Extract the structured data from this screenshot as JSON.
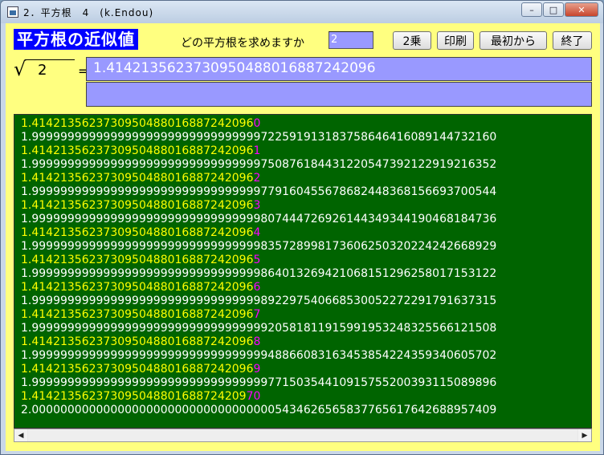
{
  "window": {
    "title": "2．平方根　4　(k.Endou)",
    "controls": {
      "minimize": "–",
      "maximize": "□",
      "close": "✕"
    }
  },
  "header": {
    "heading": "平方根の近似値",
    "question": "どの平方根を求めますか",
    "number_value": "2"
  },
  "buttons": {
    "square": "2乗",
    "print": "印刷",
    "restart": "最初から",
    "exit": "終了"
  },
  "formula": {
    "radicand": "2",
    "equals": "=",
    "result": "1.4142135623730950488016887242096",
    "result2": ""
  },
  "output": {
    "base": "1.4142135623730950488016887242096",
    "rows": [
      {
        "prefix": "1.4142135623730950488016887242096",
        "suffix": "0",
        "square": "1.99999999999999999999999999999999722591913183758646416089144732160"
      },
      {
        "prefix": "1.4142135623730950488016887242096",
        "suffix": "1",
        "square": "1.99999999999999999999999999999999750876184431220547392122919216352"
      },
      {
        "prefix": "1.4142135623730950488016887242096",
        "suffix": "2",
        "square": "1.99999999999999999999999999999999779160455678682448368156693700544"
      },
      {
        "prefix": "1.4142135623730950488016887242096",
        "suffix": "3",
        "square": "1.99999999999999999999999999999999807444726926144349344190468184736"
      },
      {
        "prefix": "1.4142135623730950488016887242096",
        "suffix": "4",
        "square": "1.99999999999999999999999999999999835728998173606250320224242668929"
      },
      {
        "prefix": "1.4142135623730950488016887242096",
        "suffix": "5",
        "square": "1.99999999999999999999999999999999864013269421068151296258017153122"
      },
      {
        "prefix": "1.4142135623730950488016887242096",
        "suffix": "6",
        "square": "1.99999999999999999999999999999999892297540668530052272291791637315"
      },
      {
        "prefix": "1.4142135623730950488016887242096",
        "suffix": "7",
        "square": "1.99999999999999999999999999999999920581811915991953248325566121508"
      },
      {
        "prefix": "1.4142135623730950488016887242096",
        "suffix": "8",
        "square": "1.99999999999999999999999999999999948866083163453854224359340605702"
      },
      {
        "prefix": "1.4142135623730950488016887242096",
        "suffix": "9",
        "square": "1.99999999999999999999999999999999977150354410915755200393115089896"
      },
      {
        "prefix": "1.414213562373095048801688724209",
        "suffix": "70",
        "square": "2.00000000000000000000000000000000005434626565837765617642688957409"
      }
    ]
  },
  "scrollbar": {
    "left_arrow": "◀",
    "right_arrow": "▶"
  },
  "colors": {
    "window_bg": "#ffff80",
    "heading_bg": "#0000ff",
    "input_bg": "#9999ff",
    "output_bg": "#006400",
    "text_yellow": "#ffff00",
    "text_white": "#ffffff",
    "text_magenta": "#ff00ff"
  }
}
